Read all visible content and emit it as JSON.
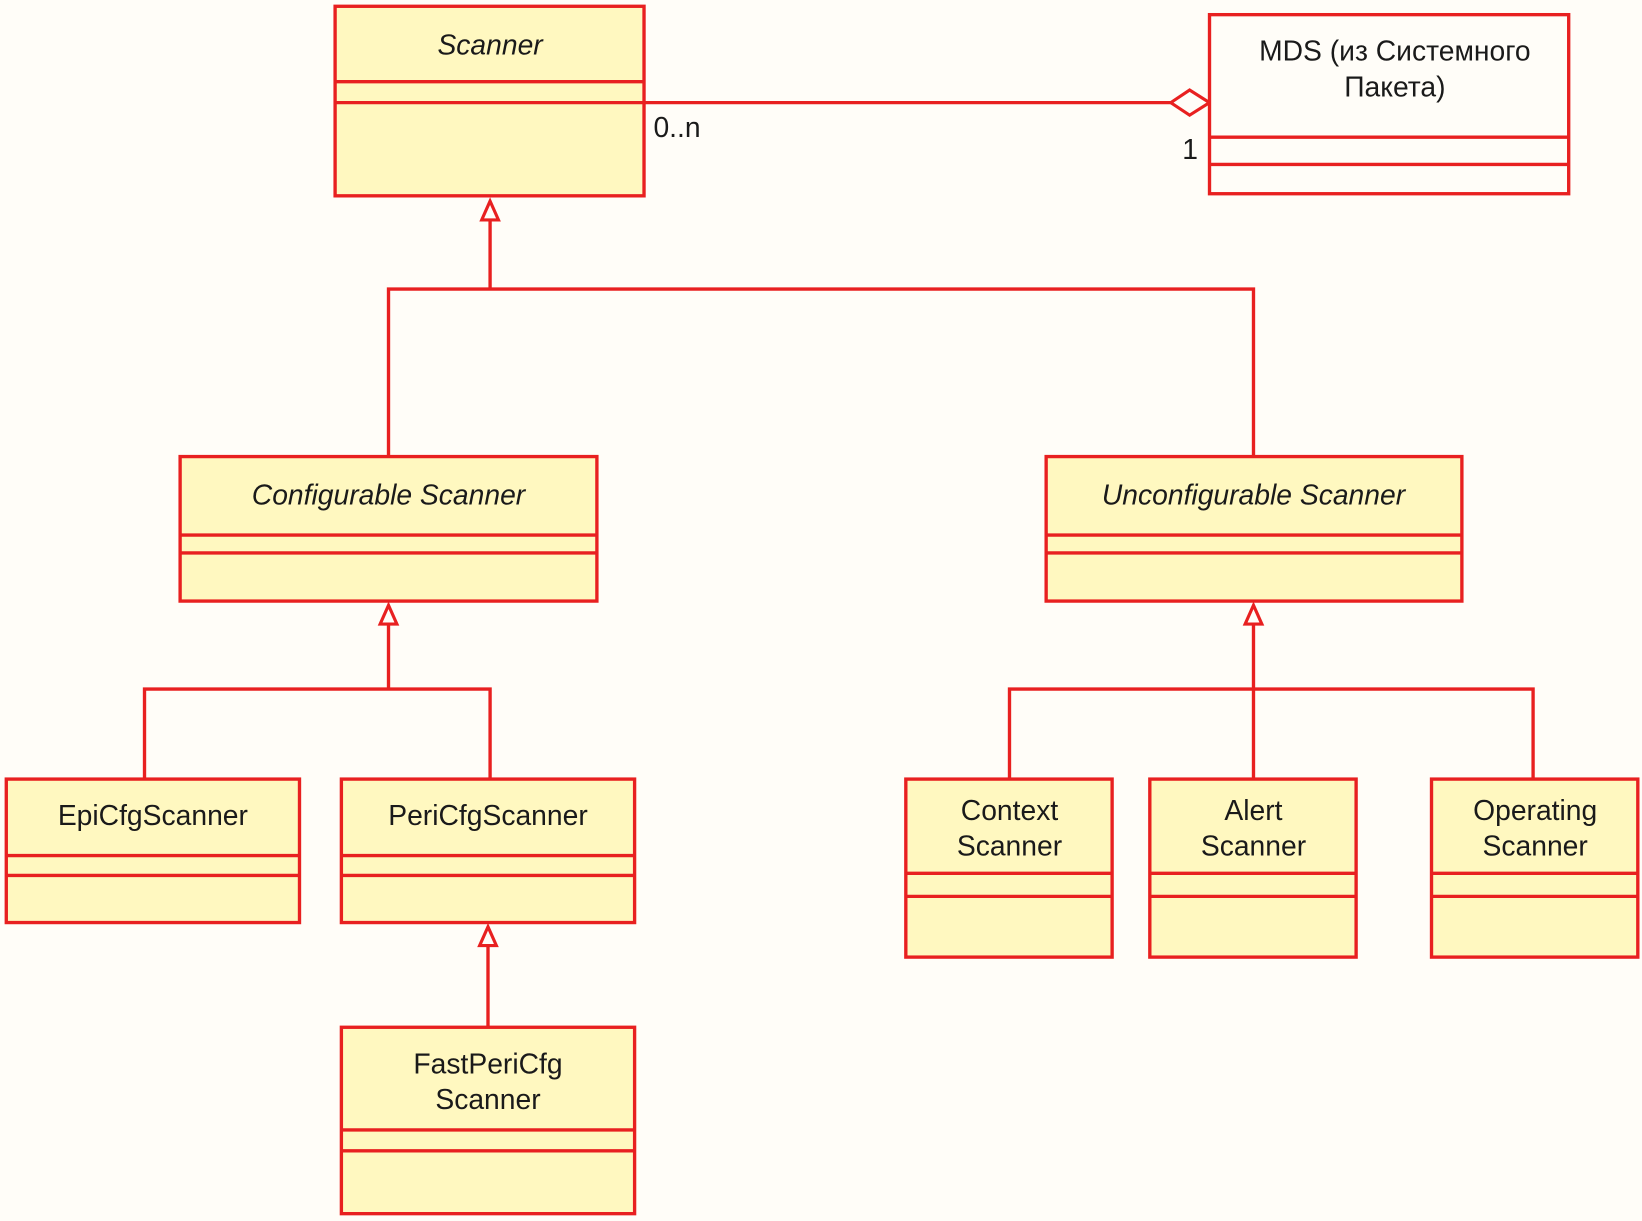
{
  "colors": {
    "background": "#fffdf8",
    "class_fill": "#fff8c0",
    "stroke": "#e82020",
    "text": "#1a1a1a"
  },
  "classes": {
    "scanner": {
      "name": "Scanner",
      "abstract": true
    },
    "mds": {
      "line1": "MDS (из Системного",
      "line2": "Пакета)"
    },
    "configurable": {
      "name": "Configurable Scanner",
      "abstract": true
    },
    "unconfigurable": {
      "name": "Unconfigurable Scanner",
      "abstract": true
    },
    "epi": {
      "name": "EpiCfgScanner"
    },
    "peri": {
      "name": "PeriCfgScanner"
    },
    "fastperi": {
      "line1": "FastPeriCfg",
      "line2": "Scanner"
    },
    "context": {
      "line1": "Context",
      "line2": "Scanner"
    },
    "alert": {
      "line1": "Alert",
      "line2": "Scanner"
    },
    "operating": {
      "line1": "Operating",
      "line2": "Scanner"
    }
  },
  "association": {
    "scanner_multiplicity": "0..n",
    "mds_multiplicity": "1",
    "type": "aggregation"
  }
}
